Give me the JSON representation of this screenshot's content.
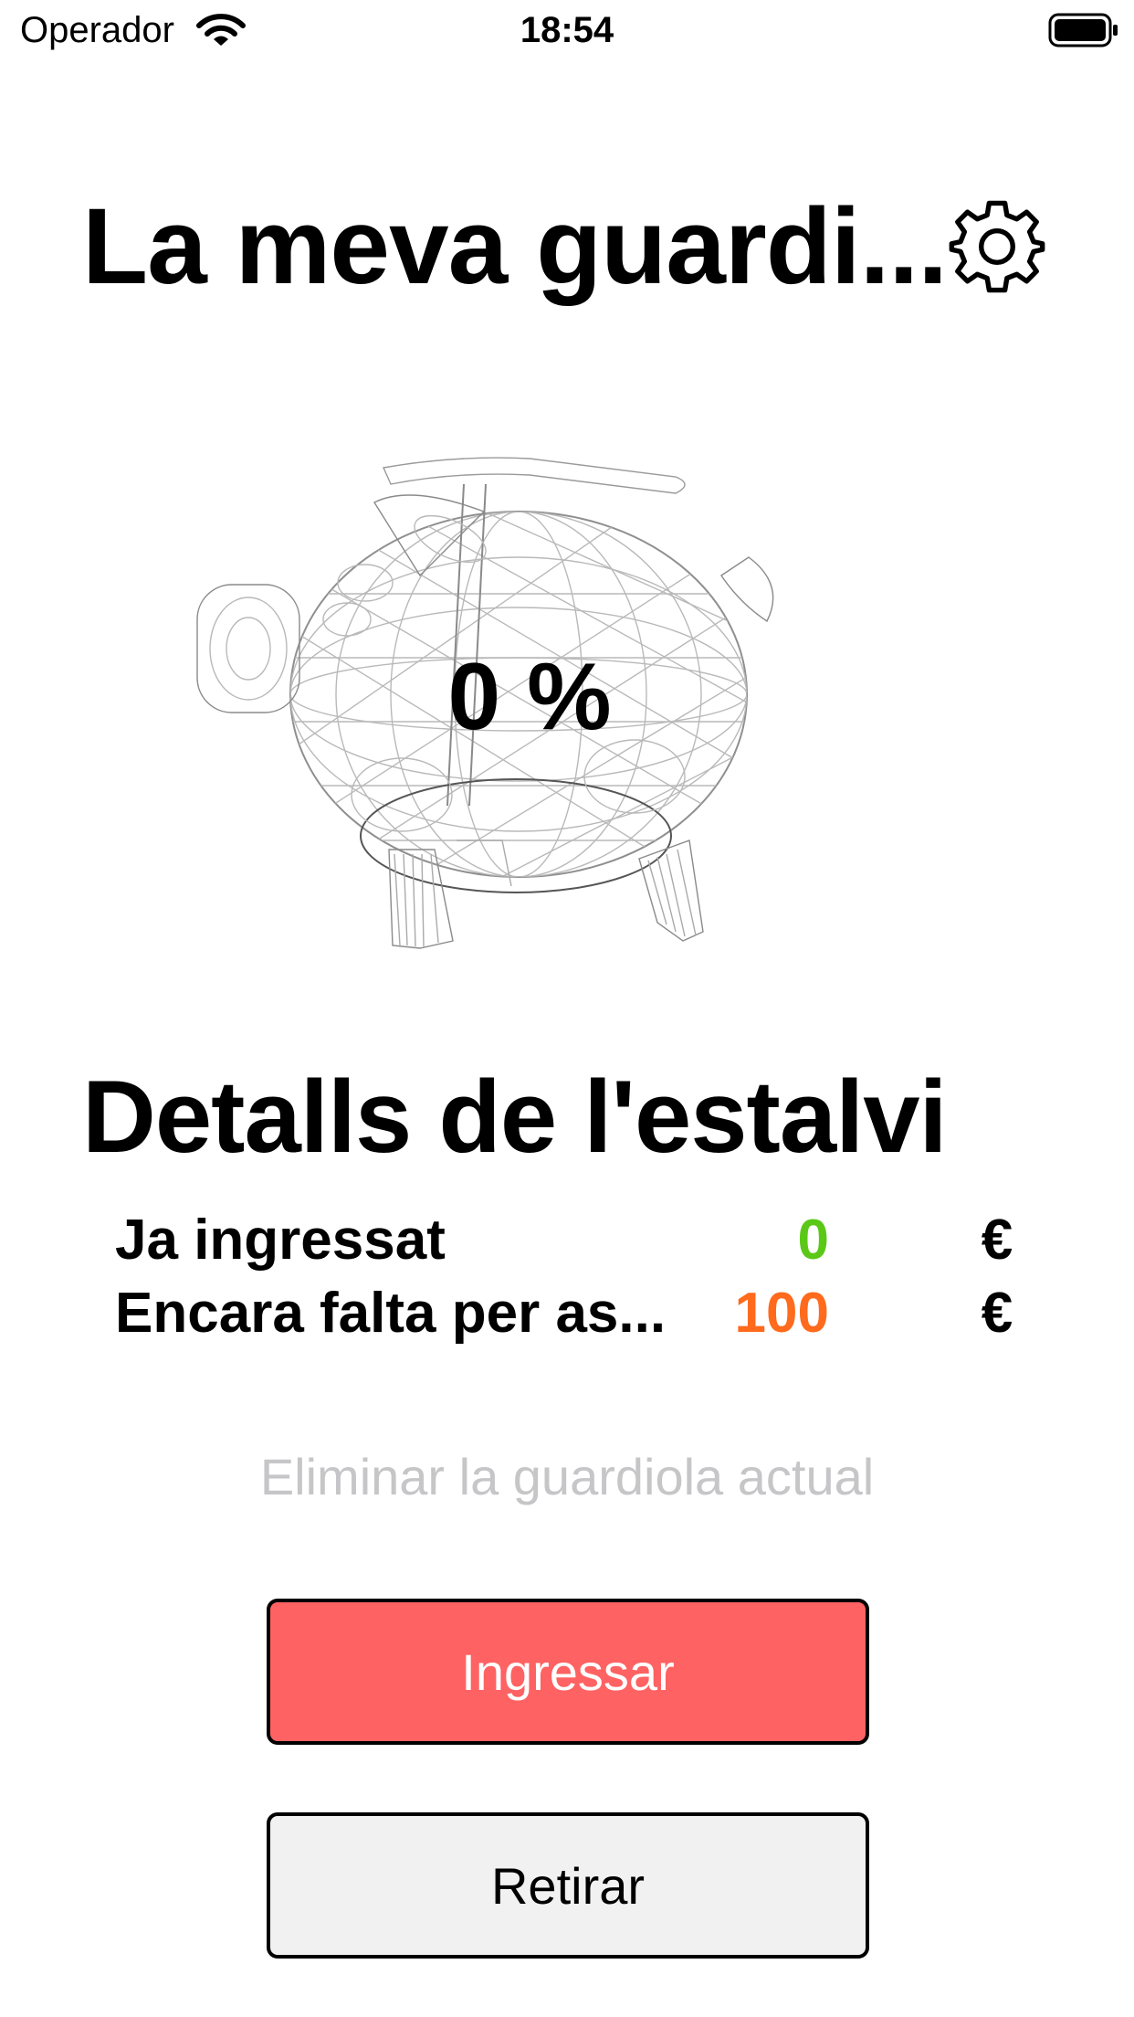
{
  "status_bar": {
    "carrier": "Operador",
    "time": "18:54"
  },
  "header": {
    "title": "La meva guardi..."
  },
  "piggy_bank": {
    "percent_label": "0 %"
  },
  "details": {
    "title": "Detalls de l'estalvi",
    "rows": [
      {
        "label": "Ja ingressat",
        "value": "0",
        "currency": "€",
        "value_color": "#5bc818"
      },
      {
        "label": "Encara falta per as...",
        "value": "100",
        "currency": "€",
        "value_color": "#ff6a1c"
      }
    ]
  },
  "actions": {
    "delete_label": "Eliminar la guardiola actual",
    "deposit_label": "Ingressar",
    "withdraw_label": "Retirar"
  },
  "colors": {
    "deposit_button": "#ff6262",
    "withdraw_button": "#f1f1f1",
    "delete_link": "#c6c6c8"
  }
}
